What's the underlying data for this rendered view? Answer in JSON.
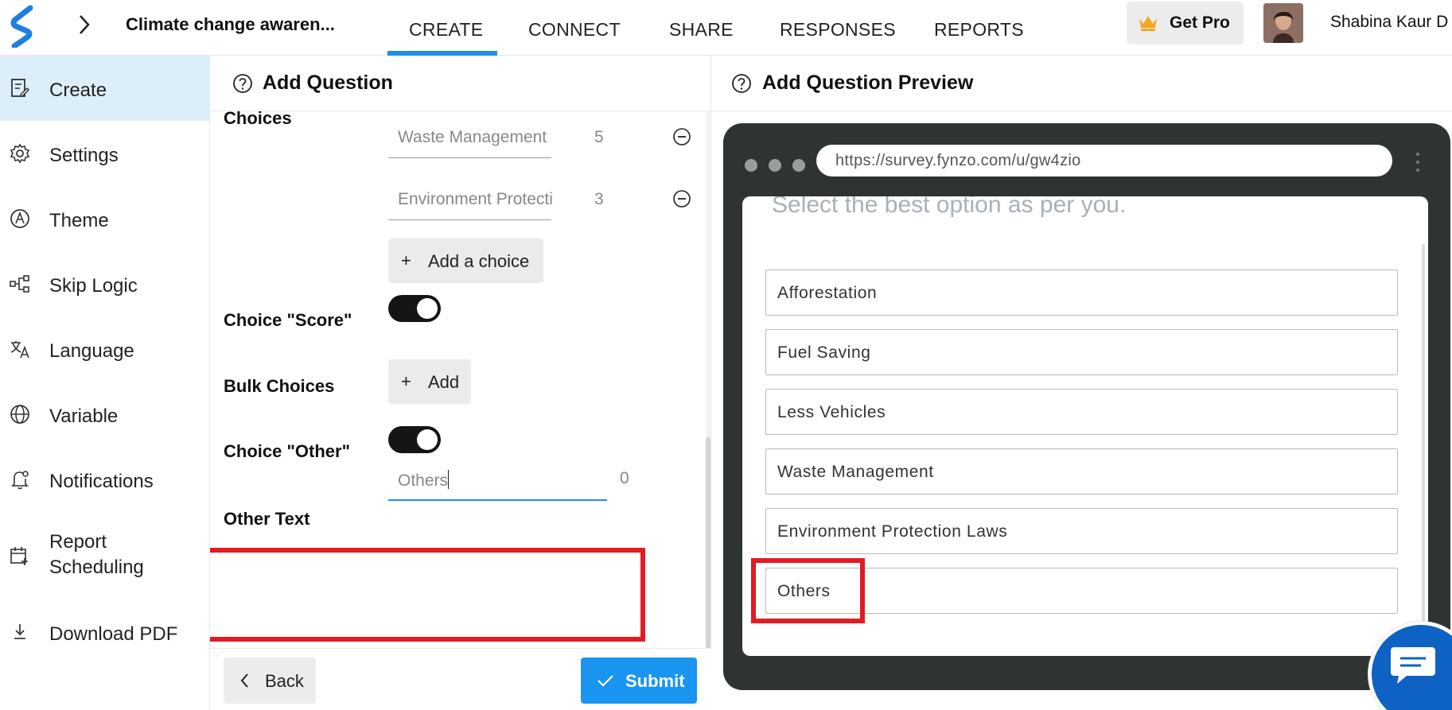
{
  "header": {
    "project_title": "Climate change awaren...",
    "tabs": [
      {
        "label": "CREATE",
        "active": true
      },
      {
        "label": "CONNECT",
        "active": false
      },
      {
        "label": "SHARE",
        "active": false
      },
      {
        "label": "RESPONSES",
        "active": false
      },
      {
        "label": "REPORTS",
        "active": false
      }
    ],
    "get_pro_label": "Get Pro",
    "user_name": "Shabina Kaur D"
  },
  "sidebar": {
    "items": [
      {
        "label": "Create",
        "icon": "create-form-icon",
        "active": true
      },
      {
        "label": "Settings",
        "icon": "gear-icon"
      },
      {
        "label": "Theme",
        "icon": "theme-icon"
      },
      {
        "label": "Skip Logic",
        "icon": "flow-icon"
      },
      {
        "label": "Language",
        "icon": "translate-icon"
      },
      {
        "label": "Variable",
        "icon": "globe-icon"
      },
      {
        "label": "Notifications",
        "icon": "bell-icon"
      },
      {
        "label": "Report\nScheduling",
        "icon": "calendar-icon"
      },
      {
        "label": "Download PDF",
        "icon": "download-icon"
      }
    ]
  },
  "editor": {
    "title": "Add Question",
    "choices_label": "Choices",
    "choices": [
      {
        "value": "Waste Management",
        "score": "5"
      },
      {
        "value": "Environment Protecti",
        "score": "3"
      }
    ],
    "add_choice_label": "Add a choice",
    "choice_score_label": "Choice \"Score\"",
    "choice_score_enabled": true,
    "bulk_choices_label": "Bulk Choices",
    "bulk_add_label": "Add",
    "choice_other_label": "Choice \"Other\"",
    "choice_other_enabled": true,
    "other_text_label": "Other Text",
    "other_text_value": "Others",
    "other_text_count": "0",
    "back_label": "Back",
    "submit_label": "Submit"
  },
  "preview": {
    "title": "Add Question Preview",
    "url": "https://survey.fynzo.com/u/gw4zio",
    "question_text": "Select the best option as per you.",
    "options": [
      "Afforestation",
      "Fuel Saving",
      "Less Vehicles",
      "Waste Management",
      "Environment Protection Laws",
      "Others"
    ]
  },
  "colors": {
    "accent": "#1e90e6",
    "highlight": "#e31b23",
    "browser_frame": "#2e3530",
    "sidebar_active": "#ddeefb",
    "chat": "#0d62c4"
  }
}
